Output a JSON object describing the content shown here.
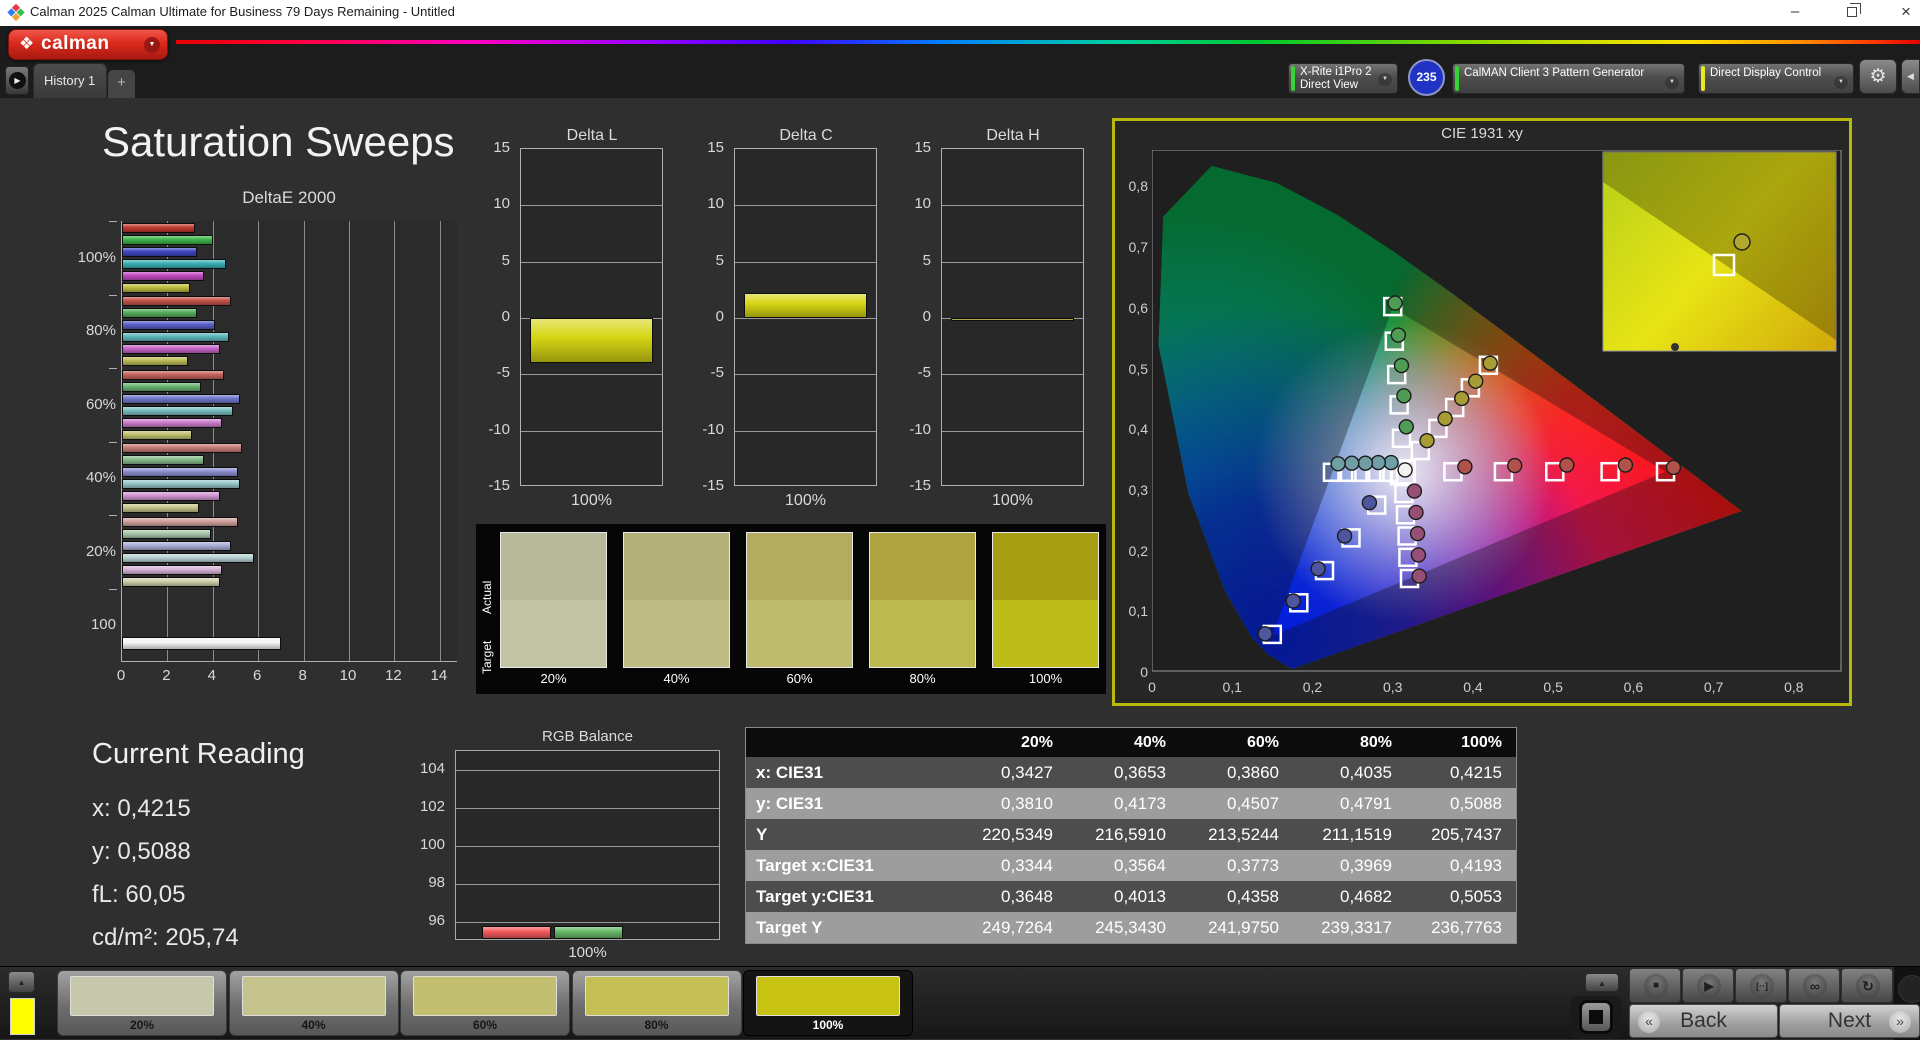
{
  "window": {
    "title": "Calman 2025 Calman Ultimate for Business 79 Days Remaining  - Untitled"
  },
  "header": {
    "brand": "calman",
    "tab": "History 1",
    "tab_add": "+",
    "meter": {
      "line1": "X-Rite i1Pro 2",
      "line2": "Direct View",
      "badge": "235",
      "status_color": "#35d435"
    },
    "source": {
      "label": "CalMAN Client 3 Pattern Generator",
      "status_color": "#35d435"
    },
    "display_control": {
      "label": "Direct Display Control",
      "status_color": "#e8e81c"
    }
  },
  "icons": {
    "stop": "■",
    "play": "▶",
    "measure": "[··]",
    "continuous": "∞",
    "refresh": "↻",
    "gear": "⚙",
    "caret_down": "▼",
    "collapse_left": "◀",
    "scroll_up": "▲",
    "tab_play": "▶",
    "back_chev": "«",
    "next_chev": "»",
    "brand_diamond": "❖",
    "minimize": "–",
    "close": "×"
  },
  "page": {
    "title": "Saturation Sweeps"
  },
  "current_reading": {
    "title": "Current Reading",
    "lines": [
      "x: 0,4215",
      "y: 0,5088",
      "fL: 60,05",
      "cd/m²: 205,74"
    ]
  },
  "table": {
    "headers": [
      "",
      "20%",
      "40%",
      "60%",
      "80%",
      "100%"
    ],
    "rows": [
      {
        "label": "x: CIE31",
        "values": [
          "0,3427",
          "0,3653",
          "0,3860",
          "0,4035",
          "0,4215"
        ]
      },
      {
        "label": "y: CIE31",
        "values": [
          "0,3810",
          "0,4173",
          "0,4507",
          "0,4791",
          "0,5088"
        ]
      },
      {
        "label": "Y",
        "values": [
          "220,5349",
          "216,5910",
          "213,5244",
          "211,1519",
          "205,7437"
        ]
      },
      {
        "label": "Target x:CIE31",
        "values": [
          "0,3344",
          "0,3564",
          "0,3773",
          "0,3969",
          "0,4193"
        ]
      },
      {
        "label": "Target y:CIE31",
        "values": [
          "0,3648",
          "0,4013",
          "0,4358",
          "0,4682",
          "0,5053"
        ]
      },
      {
        "label": "Target Y",
        "values": [
          "249,7264",
          "245,3430",
          "241,9750",
          "239,3317",
          "236,7763"
        ]
      }
    ],
    "row_colors": [
      "#4d4d4d",
      "#9d9d9d"
    ]
  },
  "swatch_panel": {
    "row_labels": [
      "Actual",
      "Target"
    ],
    "columns": [
      {
        "label": "20%",
        "actual": "#b7b99a",
        "target": "#c2c4a4"
      },
      {
        "label": "40%",
        "actual": "#b5b17b",
        "target": "#bfbd85"
      },
      {
        "label": "60%",
        "actual": "#b2ab60",
        "target": "#bebb6e"
      },
      {
        "label": "80%",
        "actual": "#aea542",
        "target": "#bdb951"
      },
      {
        "label": "100%",
        "actual": "#a89e14",
        "target": "#bebc19"
      }
    ]
  },
  "bottom_bar": {
    "current_pattern_color": "#ffff00",
    "patterns": [
      {
        "label": "20%",
        "color": "#c6c7ab",
        "selected": false
      },
      {
        "label": "40%",
        "color": "#c4c28d",
        "selected": false
      },
      {
        "label": "60%",
        "color": "#c2bf70",
        "selected": false
      },
      {
        "label": "80%",
        "color": "#c3bf55",
        "selected": false
      },
      {
        "label": "100%",
        "color": "#c8c312",
        "selected": true
      }
    ],
    "back_label": "Back",
    "next_label": "Next"
  },
  "chart_data": [
    {
      "type": "bar",
      "title": "DeltaE 2000",
      "orientation": "horizontal",
      "xlim": [
        0,
        14.8
      ],
      "xticks": [
        0,
        2,
        4,
        6,
        8,
        10,
        12,
        14
      ],
      "groups": [
        "100%",
        "80%",
        "60%",
        "40%",
        "20%",
        "100"
      ],
      "series_names": [
        "Red",
        "Green",
        "Blue",
        "Cyan",
        "Magenta",
        "Yellow"
      ],
      "values_by_group": [
        [
          3.2,
          4.0,
          3.3,
          4.6,
          3.6,
          3.0
        ],
        [
          4.8,
          3.3,
          4.1,
          4.7,
          4.3,
          2.9
        ],
        [
          4.5,
          3.5,
          5.2,
          4.9,
          4.4,
          3.1
        ],
        [
          5.3,
          3.6,
          5.1,
          5.2,
          4.3,
          3.4
        ],
        [
          5.1,
          3.9,
          4.8,
          5.8,
          4.4,
          4.3
        ],
        [
          7.0
        ]
      ],
      "colors_by_group": [
        [
          "#c23a30",
          "#3eb54c",
          "#4046c4",
          "#39b2b6",
          "#c24ac2",
          "#bfbf3e"
        ],
        [
          "#c5524a",
          "#55ae5c",
          "#585fc7",
          "#5cb8bc",
          "#c766c7",
          "#bdbd58"
        ],
        [
          "#c6645e",
          "#6bb471",
          "#7076cb",
          "#79bfc2",
          "#cb7ecb",
          "#c1c170"
        ],
        [
          "#ca7d78",
          "#88bc8c",
          "#8b90d1",
          "#97c8ca",
          "#d197d1",
          "#c6c68c"
        ],
        [
          "#cfa09c",
          "#a9c9ab",
          "#abaed8",
          "#b8d3d4",
          "#d8b4d8",
          "#cfcfac"
        ],
        [
          "#f4f4f4"
        ]
      ]
    },
    {
      "type": "bar",
      "title": "Delta L",
      "xlabel": "100%",
      "values": [
        -4.0
      ],
      "ylim": [
        -15,
        15
      ],
      "yticks": [
        15,
        10,
        5,
        0,
        -5,
        -10,
        -15
      ],
      "bar_color": "#d6d614"
    },
    {
      "type": "bar",
      "title": "Delta C",
      "xlabel": "100%",
      "values": [
        2.2
      ],
      "ylim": [
        -15,
        15
      ],
      "yticks": [
        15,
        10,
        5,
        0,
        -5,
        -10,
        -15
      ],
      "bar_color": "#d6d614"
    },
    {
      "type": "bar",
      "title": "Delta H",
      "xlabel": "100%",
      "values": [
        -0.15
      ],
      "ylim": [
        -15,
        15
      ],
      "yticks": [
        15,
        10,
        5,
        0,
        -5,
        -10,
        -15
      ],
      "bar_color": "#b8b838"
    },
    {
      "type": "bar",
      "title": "RGB Balance",
      "xlabel": "100%",
      "ylim": [
        95,
        105
      ],
      "yticks": [
        104,
        102,
        100,
        98,
        96
      ],
      "series": [
        {
          "name": "Red",
          "value": 95.7,
          "color": "#f25a5a"
        },
        {
          "name": "Green",
          "value": 95.7,
          "color": "#66b866"
        }
      ]
    },
    {
      "type": "scatter",
      "title": "CIE 1931 xy",
      "xlim": [
        0,
        0.86
      ],
      "ylim": [
        0,
        0.86
      ],
      "xtick_labels": [
        "0",
        "0,1",
        "0,2",
        "0,3",
        "0,4",
        "0,5",
        "0,6",
        "0,7",
        "0,8"
      ],
      "ytick_labels": [
        "0",
        "0,1",
        "0,2",
        "0,3",
        "0,4",
        "0,5",
        "0,6",
        "0,7",
        "0,8"
      ],
      "gamut": {
        "red": [
          0.64,
          0.33
        ],
        "green": [
          0.3,
          0.6
        ],
        "blue": [
          0.15,
          0.06
        ]
      },
      "white_point": {
        "target": [
          0.3127,
          0.329
        ],
        "measured": [
          0.3155,
          0.333
        ]
      },
      "sweeps": [
        {
          "name": "red",
          "dot_color": "#b0524a",
          "targets": [
            [
              0.375,
              0.33
            ],
            [
              0.438,
              0.33
            ],
            [
              0.502,
              0.33
            ],
            [
              0.571,
              0.33
            ],
            [
              0.64,
              0.33
            ]
          ],
          "measured": [
            [
              0.39,
              0.338
            ],
            [
              0.452,
              0.34
            ],
            [
              0.517,
              0.341
            ],
            [
              0.59,
              0.341
            ],
            [
              0.65,
              0.337
            ]
          ]
        },
        {
          "name": "green",
          "dot_color": "#4f9d55",
          "targets": [
            [
              0.311,
              0.385
            ],
            [
              0.308,
              0.44
            ],
            [
              0.305,
              0.49
            ],
            [
              0.302,
              0.545
            ],
            [
              0.3,
              0.602
            ]
          ],
          "measured": [
            [
              0.317,
              0.404
            ],
            [
              0.314,
              0.455
            ],
            [
              0.311,
              0.505
            ],
            [
              0.307,
              0.555
            ],
            [
              0.303,
              0.608
            ]
          ]
        },
        {
          "name": "blue",
          "dot_color": "#4d569e",
          "targets": [
            [
              0.28,
              0.275
            ],
            [
              0.248,
              0.221
            ],
            [
              0.215,
              0.167
            ],
            [
              0.183,
              0.114
            ],
            [
              0.15,
              0.062
            ]
          ],
          "measured": [
            [
              0.271,
              0.279
            ],
            [
              0.24,
              0.224
            ],
            [
              0.207,
              0.17
            ],
            [
              0.176,
              0.117
            ],
            [
              0.141,
              0.063
            ]
          ]
        },
        {
          "name": "cyan",
          "dot_color": "#6f9fa4",
          "targets": [
            [
              0.295,
              0.329
            ],
            [
              0.278,
              0.329
            ],
            [
              0.26,
              0.329
            ],
            [
              0.243,
              0.329
            ],
            [
              0.225,
              0.329
            ]
          ],
          "measured": [
            [
              0.298,
              0.345
            ],
            [
              0.282,
              0.345
            ],
            [
              0.266,
              0.344
            ],
            [
              0.249,
              0.344
            ],
            [
              0.232,
              0.343
            ]
          ]
        },
        {
          "name": "magenta",
          "dot_color": "#984f76",
          "targets": [
            [
              0.314,
              0.294
            ],
            [
              0.316,
              0.259
            ],
            [
              0.318,
              0.224
            ],
            [
              0.319,
              0.189
            ],
            [
              0.321,
              0.154
            ]
          ],
          "measured": [
            [
              0.327,
              0.298
            ],
            [
              0.329,
              0.263
            ],
            [
              0.331,
              0.228
            ],
            [
              0.332,
              0.193
            ],
            [
              0.333,
              0.158
            ]
          ]
        },
        {
          "name": "yellow",
          "dot_color": "#a89c35",
          "targets": [
            [
              0.3344,
              0.3648
            ],
            [
              0.3564,
              0.4013
            ],
            [
              0.3773,
              0.4358
            ],
            [
              0.3969,
              0.4682
            ],
            [
              0.4193,
              0.5053
            ]
          ],
          "measured": [
            [
              0.3427,
              0.381
            ],
            [
              0.3653,
              0.4173
            ],
            [
              0.386,
              0.4507
            ],
            [
              0.4035,
              0.4791
            ],
            [
              0.4215,
              0.5088
            ]
          ]
        }
      ],
      "inset_region": "yellow 100% detail"
    }
  ]
}
